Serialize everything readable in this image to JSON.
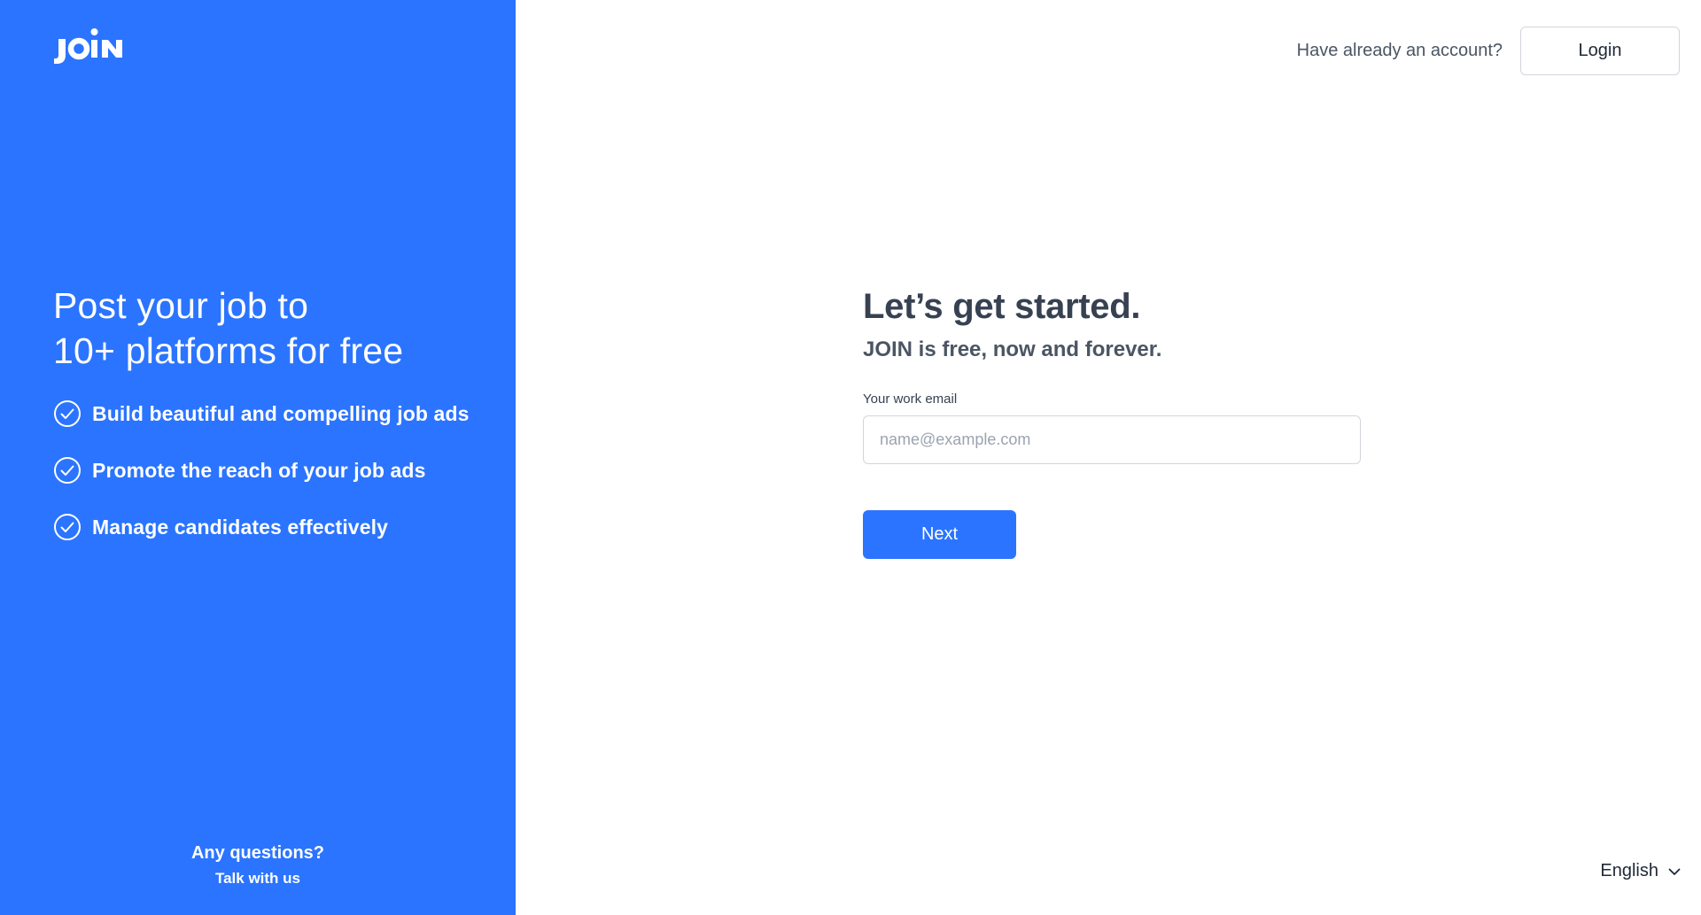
{
  "brand": {
    "logo_text": "JOIN",
    "accent_color": "#2b74ff"
  },
  "promo": {
    "title_line1": "Post your job to",
    "title_line2": "10+ platforms for free",
    "features": [
      {
        "label": "Build beautiful and compelling job ads",
        "icon": "check-circle-icon"
      },
      {
        "label": "Promote the reach of your job ads",
        "icon": "check-circle-icon"
      },
      {
        "label": "Manage candidates effectively",
        "icon": "check-circle-icon"
      }
    ],
    "help_title": "Any questions?",
    "help_link": "Talk with us"
  },
  "header": {
    "have_account": "Have already an account?",
    "login_label": "Login"
  },
  "signup": {
    "title": "Let’s get started.",
    "subtitle": "JOIN is free, now and forever.",
    "email_label": "Your work email",
    "email_placeholder": "name@example.com",
    "email_value": "",
    "next_label": "Next"
  },
  "footer": {
    "language": "English",
    "language_icon": "chevron-down-icon"
  }
}
